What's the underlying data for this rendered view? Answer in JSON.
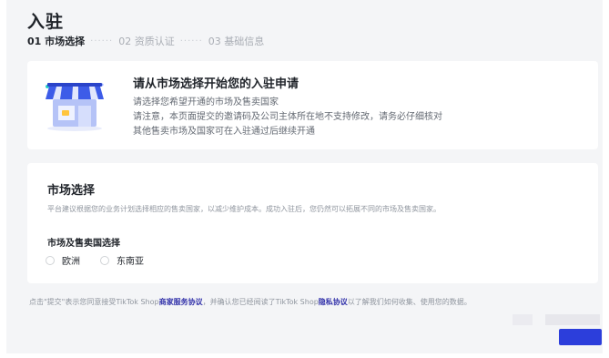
{
  "page": {
    "title": "入驻"
  },
  "steps": [
    {
      "label": "01 市场选择",
      "active": true
    },
    {
      "label": "02 资质认证",
      "active": false
    },
    {
      "label": "03 基础信息",
      "active": false
    }
  ],
  "step_separator": "······",
  "intro": {
    "heading": "请从市场选择开始您的入驻申请",
    "lines": [
      "请选择您希望开通的市场及售卖国家",
      "请注意，本页面提交的邀请码及公司主体所在地不支持修改，请务必仔细核对",
      "其他售卖市场及国家可在入驻通过后继续开通"
    ],
    "illustration": "storefront-icon"
  },
  "market": {
    "heading": "市场选择",
    "description": "平台建议根据您的业务计划选择相应的售卖国家，以减少维护成本。成功入驻后，您仍然可以拓展不同的市场及售卖国家。",
    "region_label": "市场及售卖国选择",
    "options": [
      "欧洲",
      "东南亚"
    ]
  },
  "footer": {
    "prefix": "点击\"提交\"表示您同意接受TikTok Shop",
    "link1": "商家服务协议",
    "middle": "，并确认您已经阅读了TikTok Shop",
    "link2": "隐私协议",
    "suffix": "以了解我们如何收集、使用您的数据。"
  },
  "colors": {
    "primary": "#2c3edb",
    "link": "#3333aa",
    "background": "#f4f5f7"
  }
}
